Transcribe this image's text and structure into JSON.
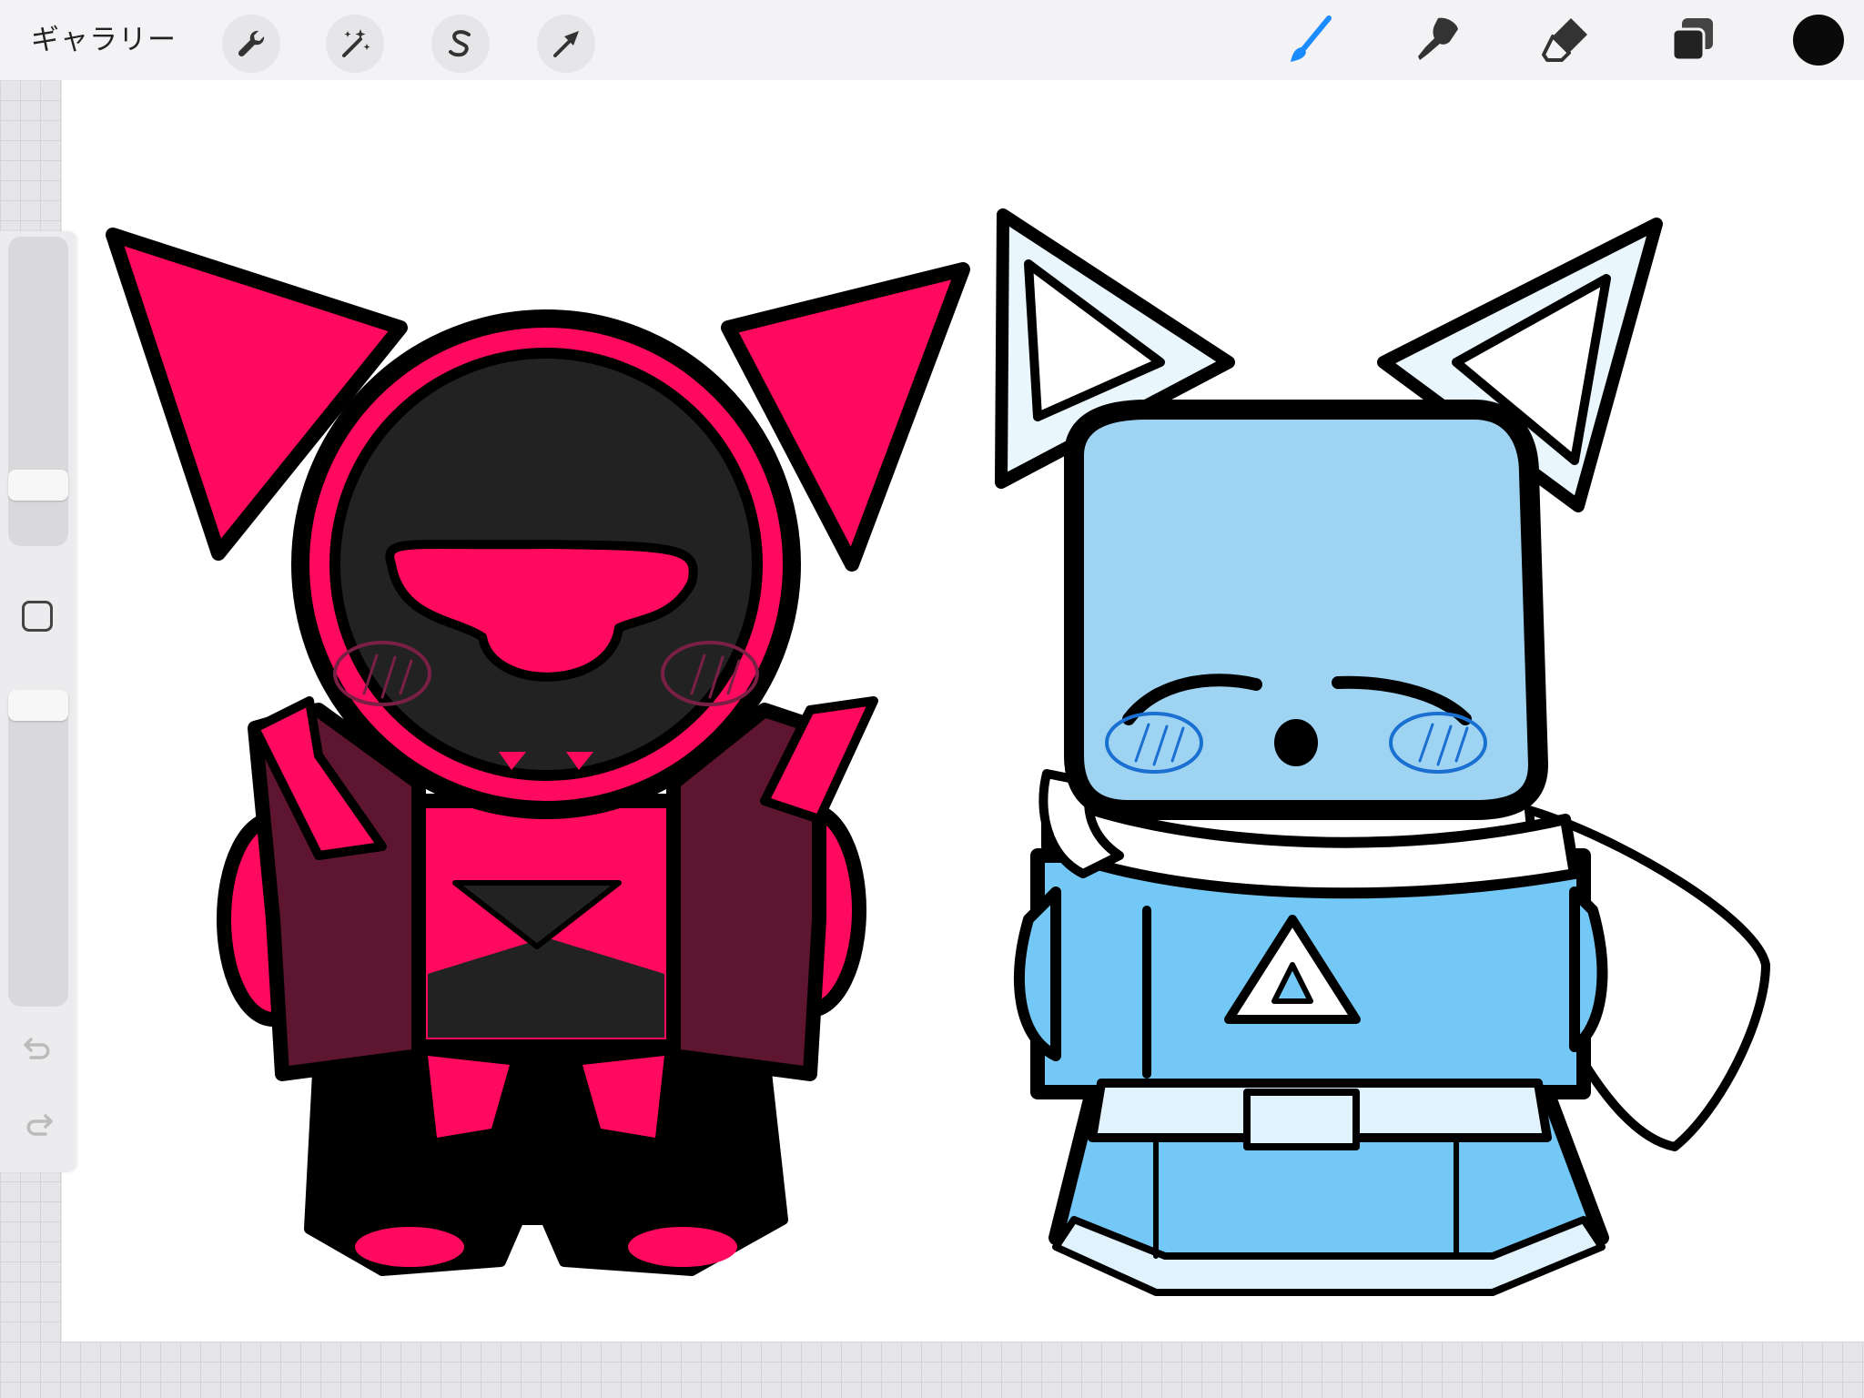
{
  "topbar": {
    "gallery_label": "ギャラリー",
    "left_tools": [
      {
        "icon": "wrench-icon",
        "name": "actions"
      },
      {
        "icon": "magic-wand-icon",
        "name": "adjustments"
      },
      {
        "icon": "selection-s-icon",
        "name": "selection"
      },
      {
        "icon": "transform-arrow-icon",
        "name": "transform"
      }
    ],
    "right_tools": [
      {
        "icon": "brush-icon",
        "name": "paint",
        "active": true
      },
      {
        "icon": "smudge-icon",
        "name": "smudge"
      },
      {
        "icon": "eraser-icon",
        "name": "erase"
      },
      {
        "icon": "layers-icon",
        "name": "layers"
      }
    ],
    "current_color": "#0a0a0a"
  },
  "colors": {
    "accent": "#1a8cff",
    "pink": "#ff0a5e",
    "dark_red": "#5e1530",
    "charcoal": "#222222",
    "light_blue": "#9ed4f2",
    "sky_blue": "#74c8f5",
    "pale_blue": "#eaf6fd"
  },
  "sidebar": {
    "brush_size_level": 0.3,
    "opacity_level": 0.0,
    "icons": [
      "modify-square-icon",
      "undo-icon",
      "redo-icon"
    ]
  }
}
